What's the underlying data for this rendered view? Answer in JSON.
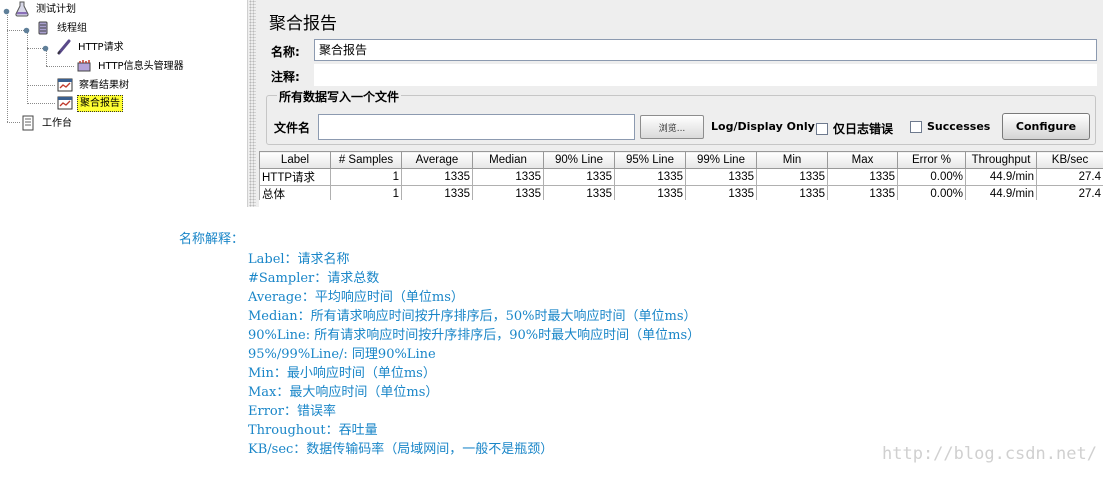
{
  "tree": {
    "items": [
      {
        "label": "测试计划",
        "icon": "test-plan-icon"
      },
      {
        "label": "线程组",
        "icon": "thread-group-icon"
      },
      {
        "label": "HTTP请求",
        "icon": "http-sampler-icon"
      },
      {
        "label": "HTTP信息头管理器",
        "icon": "header-manager-icon"
      },
      {
        "label": "察看结果树",
        "icon": "listener-icon"
      },
      {
        "label": "聚合报告",
        "icon": "listener-icon",
        "selected": true
      },
      {
        "label": "工作台",
        "icon": "workbench-icon"
      }
    ]
  },
  "panel": {
    "title": "聚合报告",
    "name_label": "名称:",
    "name_value": "聚合报告",
    "comment_label": "注释:",
    "comment_value": "",
    "file_group_title": "所有数据写入一个文件",
    "file_label": "文件名",
    "file_value": "",
    "browse_label": "浏览...",
    "log_display_label": "Log/Display Only:",
    "errors_only_label": "仅日志错误",
    "errors_only_checked": false,
    "successes_label": "Successes",
    "successes_checked": false,
    "configure_label": "Configure"
  },
  "table": {
    "columns": [
      "Label",
      "# Samples",
      "Average",
      "Median",
      "90% Line",
      "95% Line",
      "99% Line",
      "Min",
      "Max",
      "Error %",
      "Throughput",
      "KB/sec"
    ],
    "rows": [
      [
        "HTTP请求",
        "1",
        "1335",
        "1335",
        "1335",
        "1335",
        "1335",
        "1335",
        "1335",
        "0.00%",
        "44.9/min",
        "27.4"
      ],
      [
        "总体",
        "1",
        "1335",
        "1335",
        "1335",
        "1335",
        "1335",
        "1335",
        "1335",
        "0.00%",
        "44.9/min",
        "27.4"
      ]
    ]
  },
  "notes": {
    "heading": "名称解释：",
    "lines": [
      "Label：请求名称",
      "#Sampler：请求总数",
      "Average：平均响应时间（单位ms）",
      "Median：所有请求响应时间按升序排序后，50%时最大响应时间（单位ms）",
      "90%Line: 所有请求响应时间按升序排序后，90%时最大响应时间（单位ms）",
      "95%/99%Line/: 同理90%Line",
      "Min：最小响应时间（单位ms）",
      "Max：最大响应时间（单位ms）",
      "Error：错误率",
      "Throughout：吞吐量",
      "KB/sec：数据传输码率（局域网间，一般不是瓶颈）"
    ],
    "watermark": "http://blog.csdn.net/"
  },
  "colors": {
    "note_text": "#1a86c8",
    "selected_bg": "#ffff33",
    "panel_bg": "#eeeeee"
  }
}
